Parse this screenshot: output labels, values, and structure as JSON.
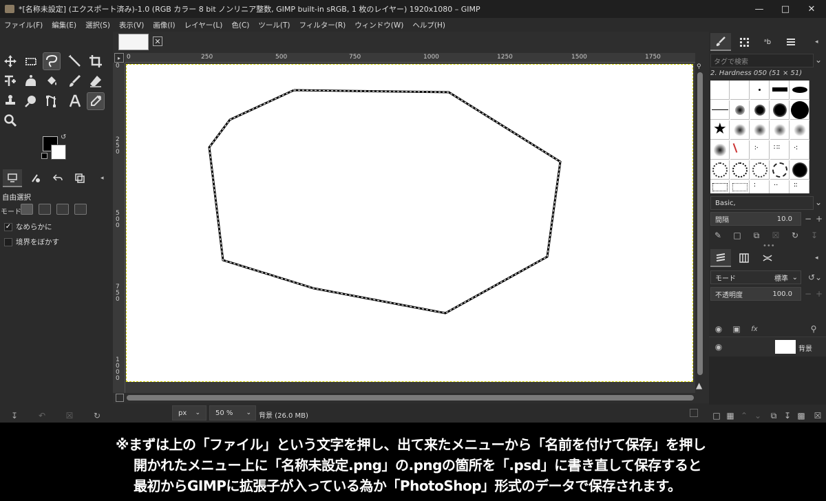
{
  "window": {
    "title": "*[名称未設定] (エクスポート済み)-1.0 (RGB カラー 8 bit ノンリニア整数, GIMP built-in sRGB, 1 枚のレイヤー) 1920x1080 – GIMP"
  },
  "menu": [
    "ファイル(F)",
    "編集(E)",
    "選択(S)",
    "表示(V)",
    "画像(I)",
    "レイヤー(L)",
    "色(C)",
    "ツール(T)",
    "フィルター(R)",
    "ウィンドウ(W)",
    "ヘルプ(H)"
  ],
  "tool_options": {
    "title": "自由選択",
    "mode_label": "モード:",
    "antialias_label": "なめらかに",
    "antialias_checked": true,
    "feather_label": "境界をぼかす",
    "feather_checked": false
  },
  "ruler": {
    "h_ticks": [
      "0",
      "250",
      "500",
      "750",
      "1000",
      "1250",
      "1500",
      "1750"
    ],
    "v_ticks": [
      "0",
      "2\n5\n0",
      "5\n0\n0",
      "7\n5\n0",
      "1\n0\n0\n0"
    ]
  },
  "status": {
    "unit": "px",
    "zoom": "50 %",
    "info": "背景 (26.0 MB)"
  },
  "brushes": {
    "tag_placeholder": "タグで検索",
    "selected_brush": "2. Hardness 050 (51 × 51)",
    "preset": "Basic,",
    "spacing_label": "間隔",
    "spacing_value": "10.0"
  },
  "layers": {
    "mode_label": "モード",
    "mode_value": "標準",
    "opacity_label": "不透明度",
    "opacity_value": "100.0",
    "layer_name": "背景"
  },
  "caption": {
    "line1": "※まずは上の「ファイル」という文字を押し、出て来たメニューから「名前を付けて保存」を押し",
    "line2": "開かれたメニュー上に「名称未設定.png」の.pngの箇所を「.psd」に書き直して保存すると",
    "line3": "最初からGIMPに拡張子が入っている為か「PhotoShop」形式のデータで保存されます。"
  }
}
